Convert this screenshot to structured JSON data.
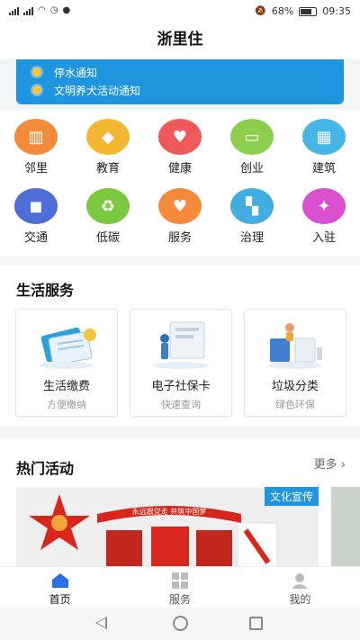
{
  "status": {
    "left": "4G 4G",
    "battery": "68%",
    "time": "09:35"
  },
  "header": {
    "title": "浙里住"
  },
  "notices": [
    "停水通知",
    "文明养犬活动通知"
  ],
  "grid": [
    {
      "label": "邻里",
      "icon": "neighborhood-icon",
      "color": "#f28a3c"
    },
    {
      "label": "教育",
      "icon": "graduation-cap-icon",
      "color": "#f5b731"
    },
    {
      "label": "健康",
      "icon": "heartbeat-icon",
      "color": "#ee5a5a"
    },
    {
      "label": "创业",
      "icon": "card-icon",
      "color": "#8ccf4d"
    },
    {
      "label": "建筑",
      "icon": "building-icon",
      "color": "#47b5e6"
    },
    {
      "label": "交通",
      "icon": "car-icon",
      "color": "#4f6fd8"
    },
    {
      "label": "低碳",
      "icon": "recycle-icon",
      "color": "#7cc93f"
    },
    {
      "label": "服务",
      "icon": "heart-hand-icon",
      "color": "#f58a3b"
    },
    {
      "label": "治理",
      "icon": "tiles-icon",
      "color": "#42aee0"
    },
    {
      "label": "入驻",
      "icon": "handshake-icon",
      "color": "#d84fd0"
    }
  ],
  "services": {
    "title": "生活服务",
    "cards": [
      {
        "name": "生活缴费",
        "sub": "方便缴纳"
      },
      {
        "name": "电子社保卡",
        "sub": "快速查询"
      },
      {
        "name": "垃圾分类",
        "sub": "绿色环保"
      }
    ]
  },
  "activities": {
    "title": "热门活动",
    "more": "更多 ›",
    "banner_tag": "文化宣传",
    "banner_text": "永远跟党走 共筑中国梦"
  },
  "tabs": [
    {
      "label": "首页",
      "icon": "home-icon"
    },
    {
      "label": "服务",
      "icon": "grid-icon"
    },
    {
      "label": "我的",
      "icon": "user-icon"
    }
  ]
}
